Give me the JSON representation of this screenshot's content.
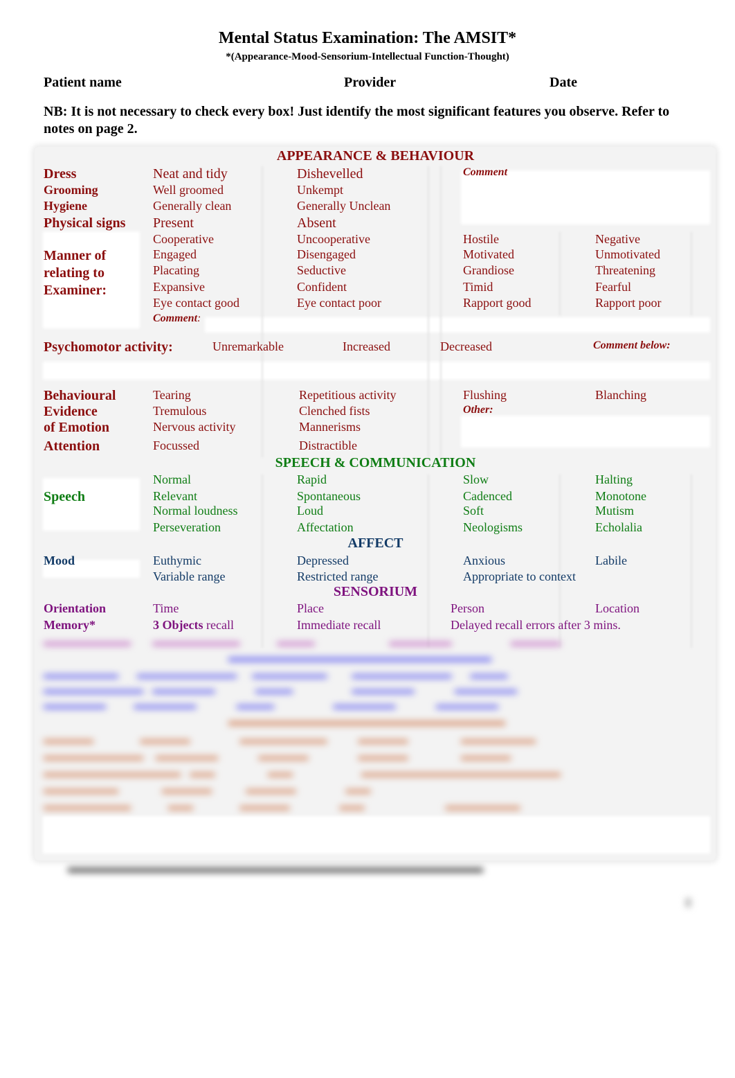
{
  "header": {
    "title": "Mental Status Examination: The AMSIT*",
    "subtitle": "*(Appearance-Mood-Sensorium-Intellectual Function-Thought)",
    "patient_label": "Patient name",
    "provider_label": "Provider",
    "date_label": "Date",
    "note": "NB: It is not necessary to check every box! Just identify the most significant features you observe. Refer to notes on page 2."
  },
  "colors": {
    "appearance": "#8b0e0e",
    "speech": "#0f7d14",
    "affect": "#123a66",
    "sensorium": "#7e127e"
  },
  "appearance": {
    "heading": "APPEARANCE & BEHAVIOUR",
    "comment_label": "Comment",
    "rows": [
      {
        "label": "Dress",
        "options": [
          "Neat and tidy",
          "Dishevelled"
        ]
      },
      {
        "label": "Grooming",
        "options": [
          "Well groomed",
          "Unkempt"
        ]
      },
      {
        "label": "Hygiene",
        "options": [
          "Generally clean",
          "Generally Unclean"
        ]
      },
      {
        "label": "Physical signs",
        "options": [
          "Present",
          "Absent"
        ]
      }
    ],
    "manner": {
      "label_lines": [
        "Manner of",
        "relating to",
        "Examiner:"
      ],
      "rows": [
        [
          "Cooperative",
          "Uncooperative",
          "Hostile",
          "Negative"
        ],
        [
          "Engaged",
          "Disengaged",
          "Motivated",
          "Unmotivated"
        ],
        [
          "Placating",
          "Seductive",
          "Grandiose",
          "Threatening"
        ],
        [
          "Expansive",
          "Confident",
          "Timid",
          "Fearful"
        ],
        [
          "Eye contact good",
          "Eye contact poor",
          "Rapport good",
          "Rapport poor"
        ]
      ],
      "comment_label": "Comment",
      "comment_suffix": ":"
    },
    "psychomotor": {
      "label": "Psychomotor activity:",
      "options": [
        "Unremarkable",
        "Increased",
        "Decreased"
      ],
      "comment_label": "Comment below:"
    },
    "behavioural": {
      "label_lines": [
        "Behavioural",
        "Evidence",
        "of Emotion"
      ],
      "rows": [
        [
          "Tearing",
          "Repetitious activity",
          "Flushing",
          "Blanching"
        ],
        [
          "Tremulous",
          "Clenched fists"
        ],
        [
          "Nervous activity",
          "Mannerisms"
        ]
      ],
      "other_label": "Other:"
    },
    "attention": {
      "label": "Attention",
      "options": [
        "Focussed",
        "Distractible"
      ]
    }
  },
  "speech": {
    "heading": "SPEECH & COMMUNICATION",
    "label": "Speech",
    "rows": [
      [
        "Normal",
        "Rapid",
        "Slow",
        "Halting"
      ],
      [
        "Relevant",
        "Spontaneous",
        "Cadenced",
        "Monotone"
      ],
      [
        "Normal loudness",
        "Loud",
        "Soft",
        "Mutism"
      ],
      [
        "Perseveration",
        "Affectation",
        "Neologisms",
        "Echolalia"
      ]
    ]
  },
  "affect": {
    "heading": "AFFECT",
    "label": "Mood",
    "rows": [
      [
        "Euthymic",
        "Depressed",
        "Anxious",
        "Labile"
      ],
      [
        "Variable range",
        "Restricted range",
        "Appropriate to context"
      ]
    ]
  },
  "sensorium": {
    "heading": "SENSORIUM",
    "orientation": {
      "label": "Orientation",
      "options": [
        "Time",
        "Place",
        "Person",
        "Location"
      ]
    },
    "memory": {
      "label": "Memory*",
      "objects_bold": "3 Objects",
      "objects_rest": " recall",
      "options": [
        "Immediate recall",
        "Delayed recall errors after 3 mins."
      ]
    }
  }
}
